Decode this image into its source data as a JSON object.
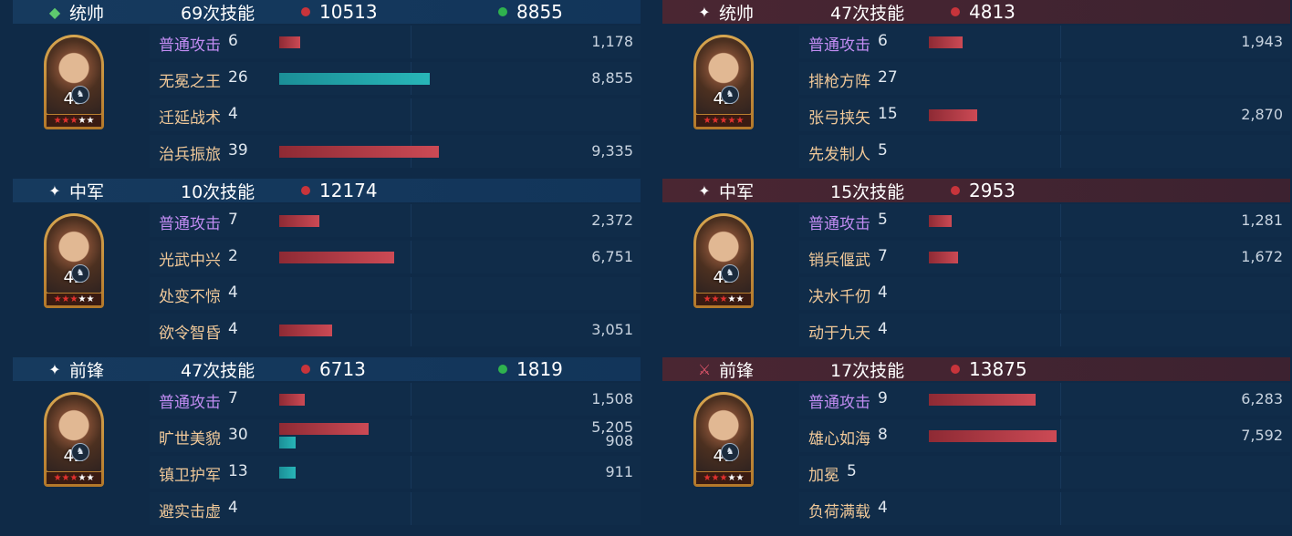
{
  "left": [
    {
      "role": "统帅",
      "mark": "gem-icon",
      "times": "69次技能",
      "red": "10513",
      "green": "8855",
      "level": "43",
      "stars_red": 3,
      "stars_total": 5,
      "skills": [
        {
          "name": "普通攻击",
          "count": "6",
          "basic": true,
          "red_fill": 0.13,
          "teal_fill": 0,
          "value": "1,178",
          "value2": ""
        },
        {
          "name": "无冕之王",
          "count": "26",
          "basic": false,
          "red_fill": 0,
          "teal_fill": 0.94,
          "value": "8,855",
          "value2": ""
        },
        {
          "name": "迁延战术",
          "count": "4",
          "basic": false,
          "red_fill": 0,
          "teal_fill": 0,
          "value": "",
          "value2": ""
        },
        {
          "name": "治兵振旅",
          "count": "39",
          "basic": false,
          "red_fill": 1.0,
          "teal_fill": 0,
          "value": "9,335",
          "value2": ""
        }
      ]
    },
    {
      "role": "中军",
      "mark": "star-icon",
      "times": "10次技能",
      "red": "12174",
      "green": "",
      "level": "42",
      "stars_red": 3,
      "stars_total": 5,
      "skills": [
        {
          "name": "普通攻击",
          "count": "7",
          "basic": true,
          "red_fill": 0.25,
          "teal_fill": 0,
          "value": "2,372",
          "value2": ""
        },
        {
          "name": "光武中兴",
          "count": "2",
          "basic": false,
          "red_fill": 0.72,
          "teal_fill": 0,
          "value": "6,751",
          "value2": ""
        },
        {
          "name": "处变不惊",
          "count": "4",
          "basic": false,
          "red_fill": 0,
          "teal_fill": 0,
          "value": "",
          "value2": ""
        },
        {
          "name": "欲令智昏",
          "count": "4",
          "basic": false,
          "red_fill": 0.33,
          "teal_fill": 0,
          "value": "3,051",
          "value2": ""
        }
      ]
    },
    {
      "role": "前锋",
      "mark": "star-icon",
      "times": "47次技能",
      "red": "6713",
      "green": "1819",
      "level": "42",
      "stars_red": 3,
      "stars_total": 5,
      "skills": [
        {
          "name": "普通攻击",
          "count": "7",
          "basic": true,
          "red_fill": 0.16,
          "teal_fill": 0,
          "value": "1,508",
          "value2": ""
        },
        {
          "name": "旷世美貌",
          "count": "30",
          "basic": false,
          "red_fill": 0.56,
          "teal_fill": 0.1,
          "value": "5,205",
          "value2": "908"
        },
        {
          "name": "镇卫护军",
          "count": "13",
          "basic": false,
          "red_fill": 0,
          "teal_fill": 0.1,
          "value": "911",
          "value2": ""
        },
        {
          "name": "避实击虚",
          "count": "4",
          "basic": false,
          "red_fill": 0,
          "teal_fill": 0,
          "value": "",
          "value2": ""
        }
      ]
    }
  ],
  "right": [
    {
      "role": "统帅",
      "mark": "star-icon",
      "times": "47次技能",
      "red": "4813",
      "green": "",
      "level": "42",
      "stars_red": 5,
      "stars_total": 5,
      "skills": [
        {
          "name": "普通攻击",
          "count": "6",
          "basic": true,
          "red_fill": 0.21,
          "teal_fill": 0,
          "value": "1,943",
          "value2": ""
        },
        {
          "name": "排枪方阵",
          "count": "27",
          "basic": false,
          "red_fill": 0,
          "teal_fill": 0,
          "value": "",
          "value2": ""
        },
        {
          "name": "张弓挟矢",
          "count": "15",
          "basic": false,
          "red_fill": 0.3,
          "teal_fill": 0,
          "value": "2,870",
          "value2": ""
        },
        {
          "name": "先发制人",
          "count": "5",
          "basic": false,
          "red_fill": 0,
          "teal_fill": 0,
          "value": "",
          "value2": ""
        }
      ]
    },
    {
      "role": "中军",
      "mark": "star-icon",
      "times": "15次技能",
      "red": "2953",
      "green": "",
      "level": "42",
      "stars_red": 3,
      "stars_total": 5,
      "skills": [
        {
          "name": "普通攻击",
          "count": "5",
          "basic": true,
          "red_fill": 0.14,
          "teal_fill": 0,
          "value": "1,281",
          "value2": ""
        },
        {
          "name": "销兵偃武",
          "count": "7",
          "basic": false,
          "red_fill": 0.18,
          "teal_fill": 0,
          "value": "1,672",
          "value2": ""
        },
        {
          "name": "决水千仞",
          "count": "4",
          "basic": false,
          "red_fill": 0,
          "teal_fill": 0,
          "value": "",
          "value2": ""
        },
        {
          "name": "动于九天",
          "count": "4",
          "basic": false,
          "red_fill": 0,
          "teal_fill": 0,
          "value": "",
          "value2": ""
        }
      ]
    },
    {
      "role": "前锋",
      "mark": "sword-icon",
      "times": "17次技能",
      "red": "13875",
      "green": "",
      "level": "41",
      "stars_red": 3,
      "stars_total": 5,
      "skills": [
        {
          "name": "普通攻击",
          "count": "9",
          "basic": true,
          "red_fill": 0.67,
          "teal_fill": 0,
          "value": "6,283",
          "value2": ""
        },
        {
          "name": "雄心如海",
          "count": "8",
          "basic": false,
          "red_fill": 0.8,
          "teal_fill": 0,
          "value": "7,592",
          "value2": ""
        },
        {
          "name": "加冕",
          "count": "5",
          "basic": false,
          "red_fill": 0,
          "teal_fill": 0,
          "value": "",
          "value2": ""
        },
        {
          "name": "负荷满载",
          "count": "4",
          "basic": false,
          "red_fill": 0,
          "teal_fill": 0,
          "value": "",
          "value2": ""
        }
      ]
    }
  ]
}
